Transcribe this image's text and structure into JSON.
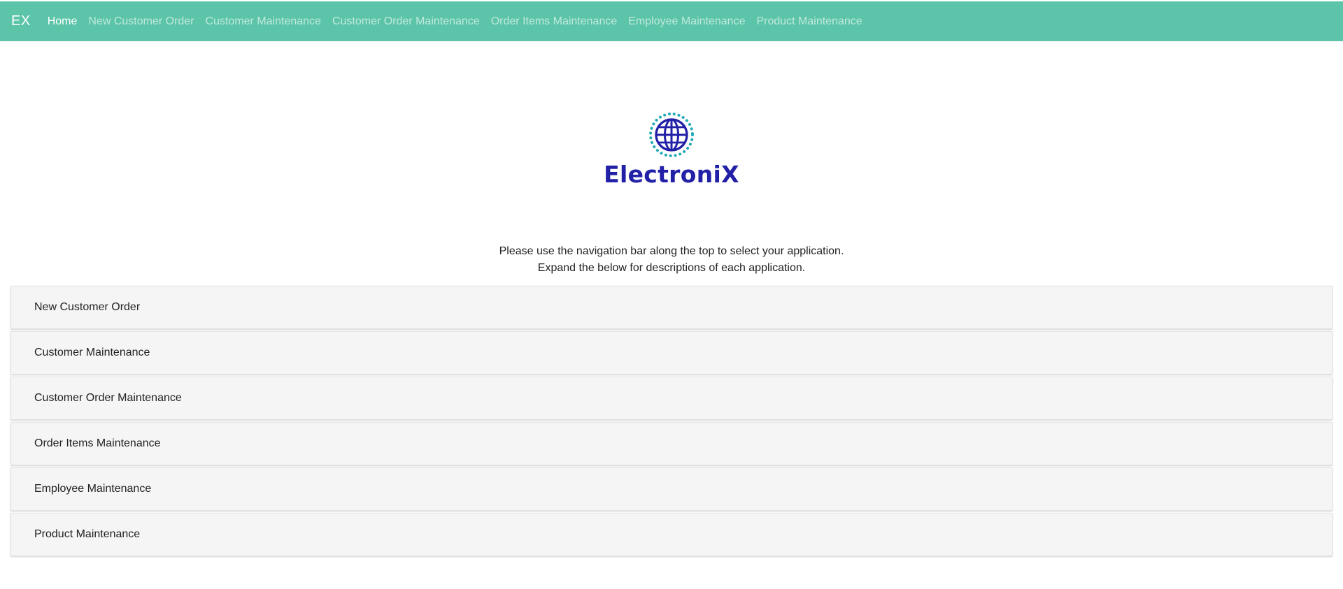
{
  "navbar": {
    "brand": "EX",
    "links": [
      {
        "label": "Home",
        "active": true
      },
      {
        "label": "New Customer Order",
        "active": false
      },
      {
        "label": "Customer Maintenance",
        "active": false
      },
      {
        "label": "Customer Order Maintenance",
        "active": false
      },
      {
        "label": "Order Items Maintenance",
        "active": false
      },
      {
        "label": "Employee Maintenance",
        "active": false
      },
      {
        "label": "Product Maintenance",
        "active": false
      }
    ]
  },
  "logo": {
    "icon": "globe-icon",
    "text": "ElectroniX"
  },
  "instructions": {
    "line1": "Please use the navigation bar along the top to select your application.",
    "line2": "Expand the below for descriptions of each application."
  },
  "accordion": {
    "items": [
      {
        "label": "New Customer Order"
      },
      {
        "label": "Customer Maintenance"
      },
      {
        "label": "Customer Order Maintenance"
      },
      {
        "label": "Order Items Maintenance"
      },
      {
        "label": "Employee Maintenance"
      },
      {
        "label": "Product Maintenance"
      }
    ]
  },
  "colors": {
    "navbar_bg": "#5bc4a9",
    "logo_blue": "#2320a8",
    "logo_teal": "#22a9b8",
    "panel_bg": "#f5f5f5"
  }
}
